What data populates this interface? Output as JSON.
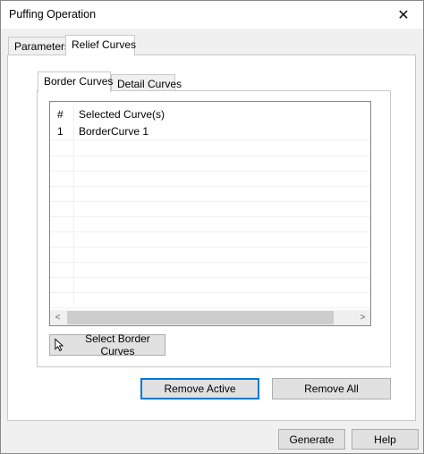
{
  "window": {
    "title": "Puffing Operation",
    "close_glyph": "✕"
  },
  "outer_tabs": [
    {
      "label": "Parameters",
      "active": false
    },
    {
      "label": "Relief Curves",
      "active": true
    }
  ],
  "inner_tabs": [
    {
      "label": "Border Curves",
      "active": true
    },
    {
      "label": "Detail Curves",
      "active": false
    }
  ],
  "listview": {
    "columns": [
      "#",
      "Selected Curve(s)"
    ],
    "rows": [
      {
        "index": "1",
        "name": "BorderCurve 1"
      }
    ],
    "scroll_left_glyph": "<",
    "scroll_right_glyph": ">"
  },
  "buttons": {
    "select_border_curves": "Select Border Curves",
    "remove_active": "Remove Active",
    "remove_all": "Remove All",
    "generate": "Generate",
    "help": "Help"
  },
  "icons": {
    "select": "cursor-arrow-icon",
    "close": "close-icon"
  },
  "colors": {
    "default_button_border": "#0078d7",
    "panel_bg": "#ffffff",
    "window_bg": "#f0f0f0"
  }
}
